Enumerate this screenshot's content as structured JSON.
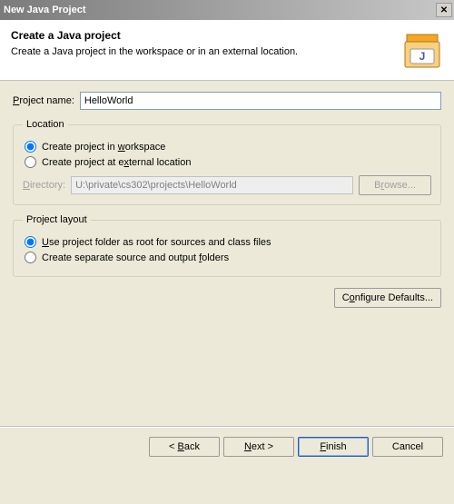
{
  "window": {
    "title": "New Java Project"
  },
  "header": {
    "title": "Create a Java project",
    "description": "Create a Java project in the workspace or in an external location."
  },
  "projectName": {
    "label": "Project name:",
    "value": "HelloWorld"
  },
  "location": {
    "legend": "Location",
    "options": {
      "workspace": "Create project in workspace",
      "external": "Create project at external location"
    },
    "selected": "workspace",
    "directoryLabel": "Directory:",
    "directoryValue": "U:\\private\\cs302\\projects\\HelloWorld",
    "browseLabel": "Browse..."
  },
  "projectLayout": {
    "legend": "Project layout",
    "options": {
      "root": "Use project folder as root for sources and class files",
      "separate": "Create separate source and output folders"
    },
    "selected": "root"
  },
  "configureDefaults": "Configure Defaults...",
  "buttons": {
    "back": "< Back",
    "next": "Next >",
    "finish": "Finish",
    "cancel": "Cancel"
  }
}
